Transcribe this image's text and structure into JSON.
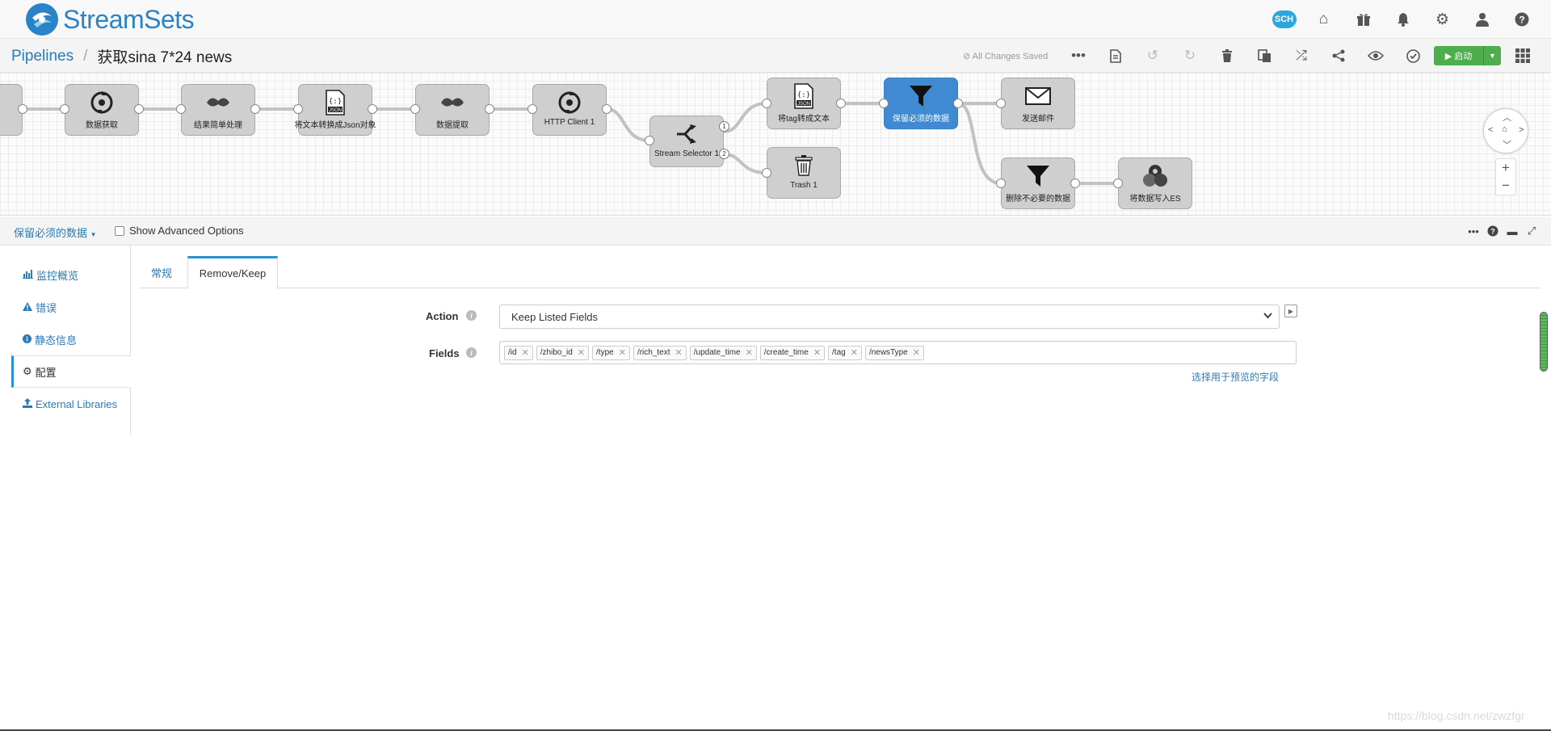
{
  "app": {
    "name": "StreamSets",
    "brand_color": "#2a83c6"
  },
  "header": {
    "icons": [
      "sch-cloud-icon",
      "home-icon",
      "gift-icon",
      "bell-icon",
      "gears-icon",
      "user-icon",
      "help-icon"
    ],
    "sch_label": "SCH"
  },
  "breadcrumb": {
    "root": "Pipelines",
    "separator": "/",
    "current": "获取sina 7*24 news"
  },
  "toolbar": {
    "save_status": "All Changes Saved",
    "run_label": "▶ 启动"
  },
  "pipeline": {
    "stages": [
      {
        "label": "",
        "icon": "stage-left-icon"
      },
      {
        "label": "数据获取",
        "icon": "refresh-icon"
      },
      {
        "label": "结果简单处理",
        "icon": "groovy-icon"
      },
      {
        "label": "将文本转换成Json对象",
        "icon": "json-icon"
      },
      {
        "label": "数据提取",
        "icon": "groovy-icon"
      },
      {
        "label": "HTTP Client 1",
        "icon": "refresh-icon"
      },
      {
        "label": "Stream Selector 1",
        "icon": "selector-icon"
      },
      {
        "label": "将tag转成文本",
        "icon": "json-icon"
      },
      {
        "label": "Trash 1",
        "icon": "trash-icon"
      },
      {
        "label": "保留必须的数据",
        "icon": "filter-icon"
      },
      {
        "label": "发送邮件",
        "icon": "mail-icon"
      },
      {
        "label": "删除不必要的数据",
        "icon": "filter-icon"
      },
      {
        "label": "将数据写入ES",
        "icon": "es-icon"
      }
    ],
    "selector_outputs": [
      "1",
      "2"
    ]
  },
  "pane": {
    "selected_stage": "保留必须的数据",
    "show_advanced_label": "Show Advanced Options",
    "left_nav": [
      {
        "label": "监控概览",
        "icon": "chart-icon"
      },
      {
        "label": "错误",
        "icon": "warning-icon"
      },
      {
        "label": "静态信息",
        "icon": "info-icon"
      },
      {
        "label": "配置",
        "icon": "gear-icon"
      },
      {
        "label": "External Libraries",
        "icon": "upload-icon"
      }
    ],
    "tabs": [
      "常规",
      "Remove/Keep"
    ],
    "form": {
      "action_label": "Action",
      "action_value": "Keep Listed Fields",
      "fields_label": "Fields",
      "fields": [
        "/id",
        "/zhibo_id",
        "/type",
        "/rich_text",
        "/update_time",
        "/create_time",
        "/tag",
        "/newsType"
      ],
      "pick_fields_link": "选择用于预览的字段"
    }
  },
  "watermark": "https://blog.csdn.net/zwzfgr"
}
